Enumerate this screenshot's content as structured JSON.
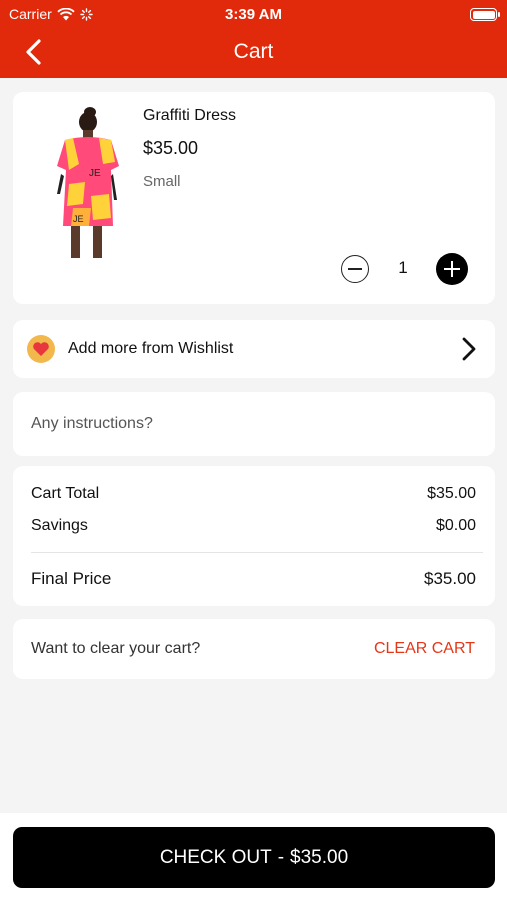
{
  "status_bar": {
    "carrier": "Carrier",
    "time": "3:39 AM"
  },
  "header": {
    "title": "Cart"
  },
  "cart_item": {
    "name": "Graffiti Dress",
    "price": "$35.00",
    "size": "Small",
    "quantity": "1"
  },
  "wishlist": {
    "label": "Add more from Wishlist"
  },
  "instructions": {
    "placeholder": "Any instructions?"
  },
  "totals": {
    "cart_total_label": "Cart Total",
    "cart_total_value": "$35.00",
    "savings_label": "Savings",
    "savings_value": "$0.00",
    "final_label": "Final Price",
    "final_value": "$35.00"
  },
  "clear": {
    "question": "Want to clear your cart?",
    "button": "CLEAR CART"
  },
  "checkout": {
    "label": "CHECK OUT",
    "separator": "-",
    "amount": "$35.00"
  },
  "colors": {
    "brand_red": "#e12a0b",
    "clear_red": "#e53617",
    "heart_badge": "#f2b84b"
  }
}
